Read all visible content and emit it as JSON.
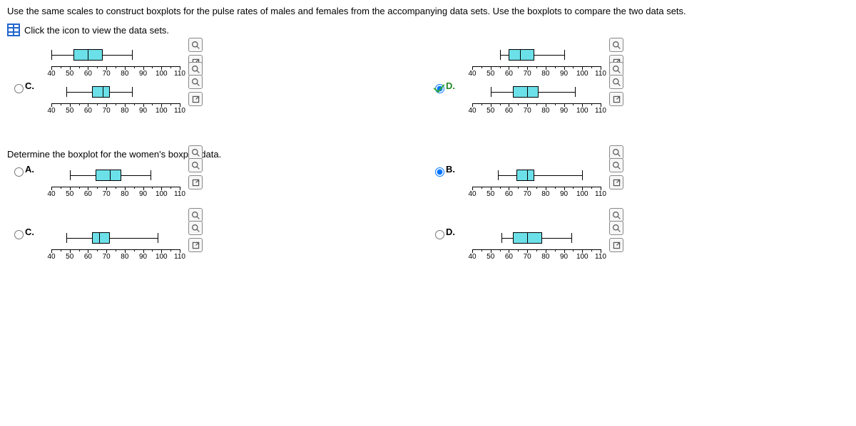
{
  "question": "Use the same scales to construct boxplots for the pulse rates of males and females from the accompanying data sets. Use the boxplots to compare the two data sets.",
  "hint": "Click the icon to view the data sets.",
  "axis": {
    "min": 40,
    "max": 110,
    "ticks": [
      40,
      50,
      60,
      70,
      80,
      90,
      100,
      110
    ]
  },
  "top_left": {
    "min": 40,
    "q1": 52,
    "med": 60,
    "q3": 68,
    "max": 84
  },
  "top_right": {
    "min": 55,
    "q1": 60,
    "med": 66,
    "q3": 74,
    "max": 90
  },
  "q1_title": "Determine the boxplot for the women's boxplot data.",
  "q1": {
    "C": {
      "min": 48,
      "q1": 62,
      "med": 68,
      "q3": 72,
      "max": 84
    },
    "D": {
      "min": 50,
      "q1": 62,
      "med": 70,
      "q3": 76,
      "max": 96
    }
  },
  "q2": {
    "A": {
      "min": 50,
      "q1": 64,
      "med": 72,
      "q3": 78,
      "max": 94
    },
    "B": {
      "min": 54,
      "q1": 64,
      "med": 70,
      "q3": 74,
      "max": 100
    },
    "C": {
      "min": 48,
      "q1": 62,
      "med": 66,
      "q3": 72,
      "max": 98
    },
    "D": {
      "min": 56,
      "q1": 62,
      "med": 70,
      "q3": 78,
      "max": 94
    }
  },
  "labels": {
    "A": "A.",
    "B": "B.",
    "C": "C.",
    "D": "D."
  }
}
